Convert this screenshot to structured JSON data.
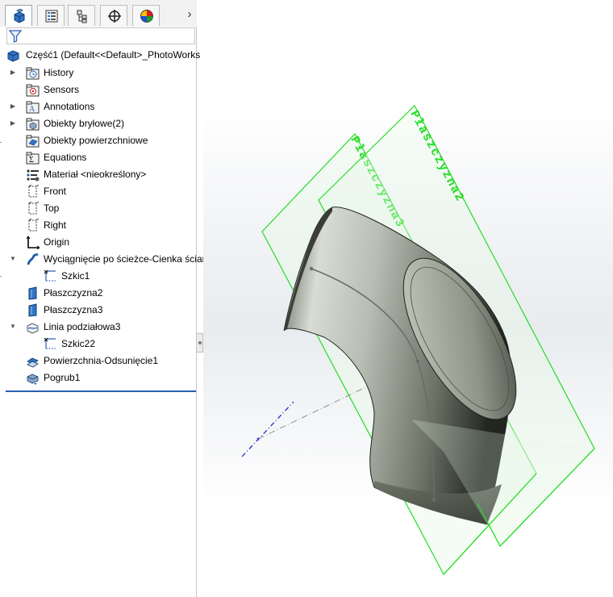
{
  "tree": {
    "root": "Część1  (Default<<Default>_PhotoWorks",
    "items": [
      {
        "label": "History",
        "icon": "history-folder-icon",
        "expander": "collapsed"
      },
      {
        "label": "Sensors",
        "icon": "sensors-folder-icon",
        "expander": "none"
      },
      {
        "label": "Annotations",
        "icon": "annotations-folder-icon",
        "expander": "collapsed"
      },
      {
        "label": "Obiekty bryłowe(2)",
        "icon": "solid-bodies-folder-icon",
        "expander": "collapsed"
      },
      {
        "label": "Obiekty powierzchniowe",
        "icon": "surface-bodies-folder-icon",
        "expander": "none"
      },
      {
        "label": "Equations",
        "icon": "equations-folder-icon",
        "expander": "none"
      },
      {
        "label": "Materiał <nieokreślony>",
        "icon": "material-icon",
        "expander": "none"
      },
      {
        "label": "Front",
        "icon": "plane-icon",
        "expander": "none"
      },
      {
        "label": "Top",
        "icon": "plane-icon",
        "expander": "none"
      },
      {
        "label": "Right",
        "icon": "plane-icon",
        "expander": "none"
      },
      {
        "label": "Origin",
        "icon": "origin-icon",
        "expander": "none"
      },
      {
        "label": "Wyciągnięcie po ścieżce-Cienka ściar",
        "icon": "sweep-feature-icon",
        "expander": "expanded"
      },
      {
        "label": "Szkic1",
        "icon": "sketch-icon",
        "expander": "child"
      },
      {
        "label": "Płaszczyzna2",
        "icon": "plane-feature-icon",
        "expander": "none"
      },
      {
        "label": "Płaszczyzna3",
        "icon": "plane-feature-icon",
        "expander": "none"
      },
      {
        "label": "Linia podziałowa3",
        "icon": "split-line-icon",
        "expander": "expanded"
      },
      {
        "label": "Szkic22",
        "icon": "sketch-icon",
        "expander": "child"
      },
      {
        "label": "Powierzchnia-Odsunięcie1",
        "icon": "offset-surface-icon",
        "expander": "none"
      },
      {
        "label": "Pogrub1",
        "icon": "thicken-icon",
        "expander": "none"
      }
    ]
  },
  "tabs": [
    {
      "name": "feature-manager-tab",
      "icon": "feature-manager-icon"
    },
    {
      "name": "property-manager-tab",
      "icon": "property-manager-icon"
    },
    {
      "name": "configuration-manager-tab",
      "icon": "configuration-manager-icon"
    },
    {
      "name": "dimxpert-manager-tab",
      "icon": "dimxpert-icon"
    },
    {
      "name": "display-manager-tab",
      "icon": "display-manager-icon"
    }
  ],
  "viewport": {
    "plane_labels": [
      "Płaszczyzna2",
      "Płaszczyzna3"
    ],
    "plane_color": "#22dd22",
    "body_color": "#8a9184",
    "axis_color": "#1a1acc"
  }
}
